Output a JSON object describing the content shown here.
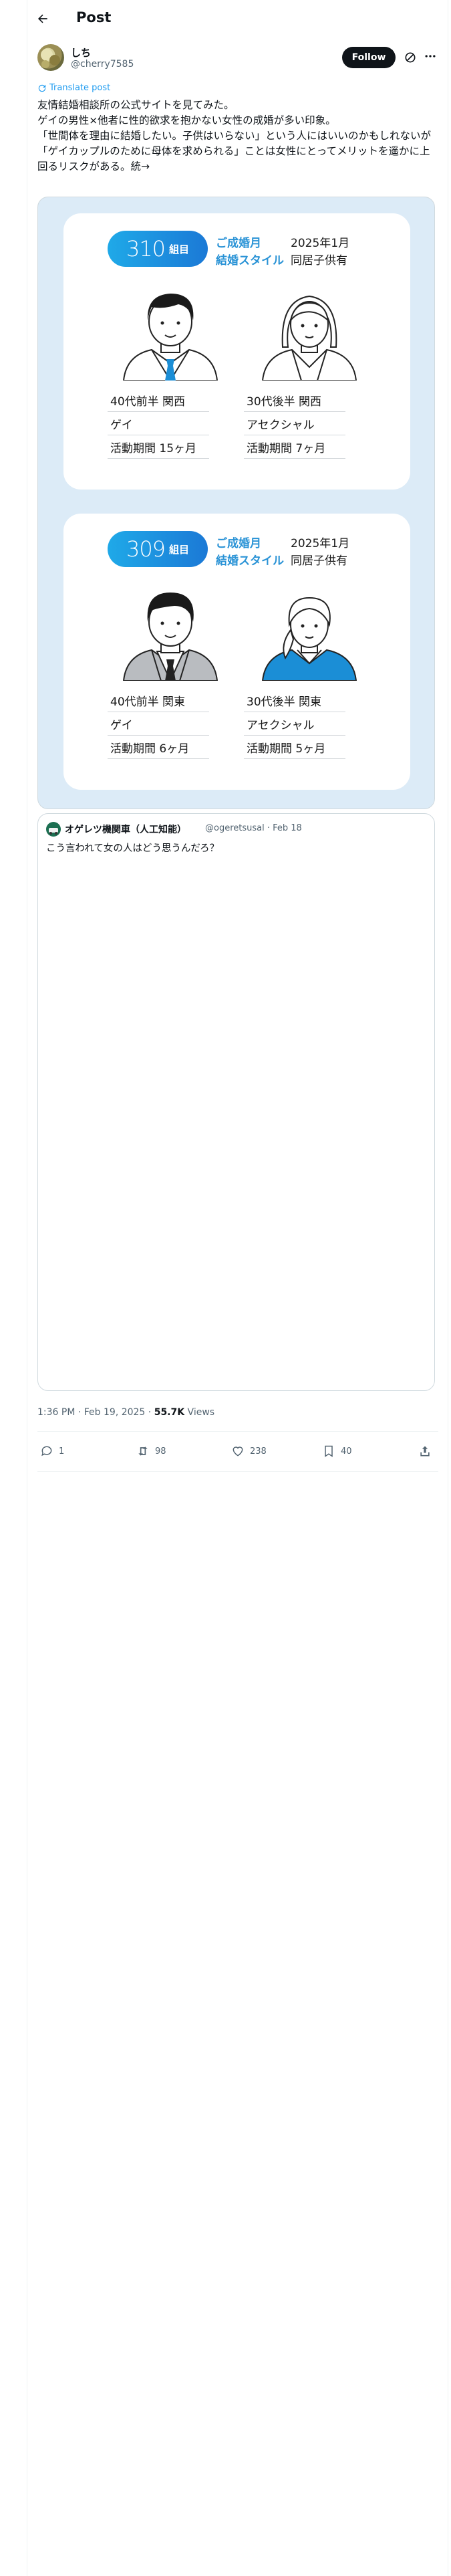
{
  "header": {
    "title": "Post"
  },
  "author": {
    "name": "しち",
    "handle": "@cherry7585",
    "follow_label": "Follow"
  },
  "translate_label": "Translate post",
  "tweet_text": "友情結婚相談所の公式サイトを見てみた。\nゲイの男性×他者に性的欲求を抱かない女性の成婚が多い印象。\n「世間体を理由に結婚したい。子供はいらない」という人にはいいのかもしれないが「ゲイカップルのために母体を求められる」ことは女性にとってメリットを遥かに上回るリスクがある。統→",
  "image": {
    "cards": [
      {
        "badge_number": "310",
        "badge_unit": "組目",
        "month_label": "ご成婚月",
        "month_value": "2025年1月",
        "style_label": "結婚スタイル",
        "style_value": "同居子供有",
        "left": [
          "40代前半 関西",
          "ゲイ",
          "活動期間 15ヶ月"
        ],
        "right": [
          "30代後半 関西",
          "アセクシャル",
          "活動期間 7ヶ月"
        ]
      },
      {
        "badge_number": "309",
        "badge_unit": "組目",
        "month_label": "ご成婚月",
        "month_value": "2025年1月",
        "style_label": "結婚スタイル",
        "style_value": "同居子供有",
        "left": [
          "40代前半 関東",
          "ゲイ",
          "活動期間 6ヶ月"
        ],
        "right": [
          "30代後半 関東",
          "アセクシャル",
          "活動期間 5ヶ月"
        ]
      }
    ]
  },
  "quote": {
    "name": "オゲレツ機関車（人工知能）",
    "handle_date": "@ogeretsusal · Feb 18",
    "text": "こう言われて女の人はどう思うんだろ？"
  },
  "timestamp": {
    "time": "1:36 PM · Feb 19, 2025 · ",
    "views_count": "55.7K",
    "views_label": " Views"
  },
  "actions": {
    "replies": "1",
    "reposts": "98",
    "likes": "238",
    "bookmarks": "40"
  },
  "colors": {
    "accent": "#1d9bf0",
    "badge_blue": "#1b79d6",
    "image_bg": "#dcebf7"
  }
}
